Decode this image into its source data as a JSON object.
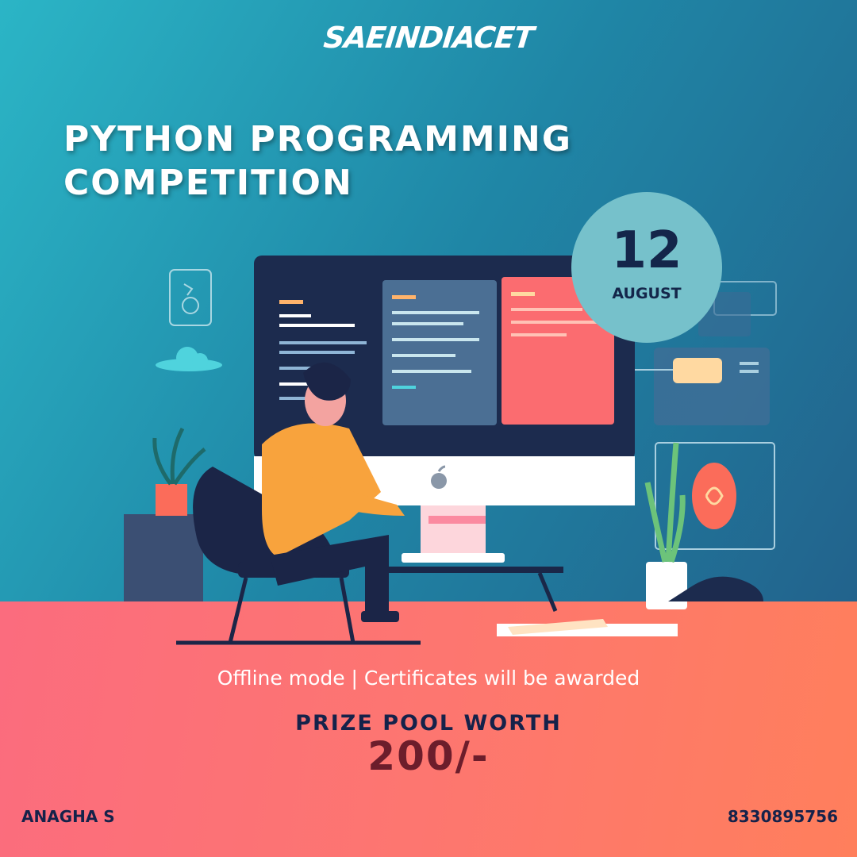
{
  "brand": {
    "logo_text": "SAEINDIACET"
  },
  "event": {
    "title_line1": "PYTHON PROGRAMMING",
    "title_line2": "COMPETITION",
    "date_day": "12",
    "date_month": "AUGUST",
    "details": "Offline mode | Certificates will be awarded",
    "prize_label": "PRIZE POOL WORTH",
    "prize_value": "200/-"
  },
  "contact": {
    "name": "ANAGHA S",
    "phone": "8330895756"
  },
  "colors": {
    "background_teal": "#2bb5c6",
    "background_navy": "#235a86",
    "floor_coral": "#fd7670",
    "badge": "#76c1cb",
    "text_dark_navy": "#15224a",
    "prize_maroon": "#6c1d2b"
  },
  "illustration": {
    "icons": [
      "monitor-icon",
      "apple-logo-icon",
      "cloud-icon",
      "plant-icon",
      "chair-icon",
      "person-icon",
      "code-panel-icon"
    ]
  }
}
